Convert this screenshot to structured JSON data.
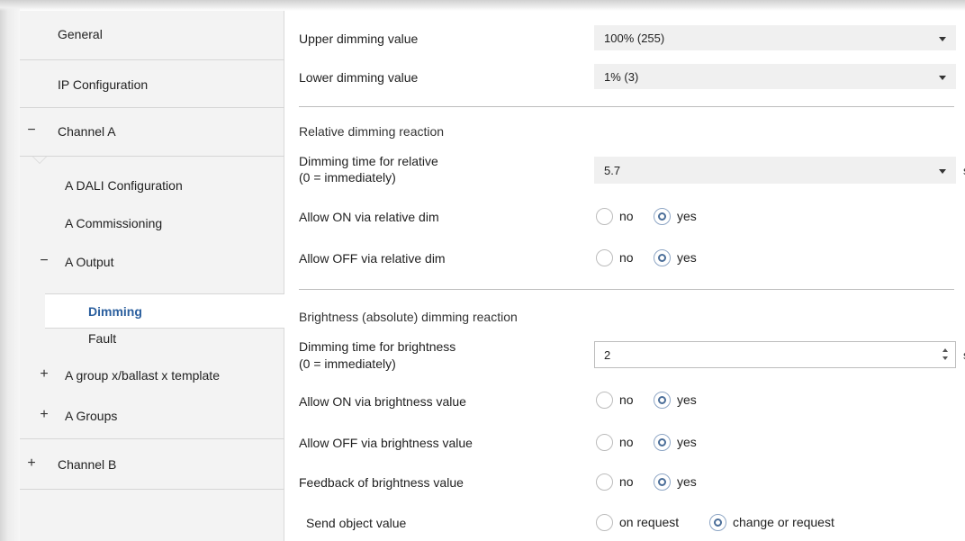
{
  "sidebar": {
    "items": [
      {
        "label": "General",
        "sign": ""
      },
      {
        "label": "IP Configuration",
        "sign": ""
      },
      {
        "label": "Channel A",
        "sign": "−"
      },
      {
        "label": "A DALI Configuration",
        "sign": ""
      },
      {
        "label": "A Commissioning",
        "sign": ""
      },
      {
        "label": "A Output",
        "sign": "−"
      },
      {
        "label": "Dimming",
        "sign": ""
      },
      {
        "label": "Fault",
        "sign": ""
      },
      {
        "label": "A group x/ballast x template",
        "sign": "+"
      },
      {
        "label": "A Groups",
        "sign": "+"
      },
      {
        "label": "Channel B",
        "sign": "+"
      }
    ],
    "selected": "Dimming"
  },
  "main": {
    "upper_dimming": {
      "label": "Upper dimming value",
      "value": "100% (255)"
    },
    "lower_dimming": {
      "label": "Lower dimming value",
      "value": "1% (3)"
    },
    "relative_section": {
      "title": "Relative dimming reaction"
    },
    "relative_time": {
      "label_line1": "Dimming time for relative",
      "label_line2": "(0 = immediately)",
      "value": "5.7",
      "unit": "s"
    },
    "allow_on_relative": {
      "label": "Allow ON via relative dim",
      "options": [
        "no",
        "yes"
      ],
      "selected": "yes"
    },
    "allow_off_relative": {
      "label": "Allow OFF via relative dim",
      "options": [
        "no",
        "yes"
      ],
      "selected": "yes"
    },
    "brightness_section": {
      "title": "Brightness (absolute) dimming reaction"
    },
    "brightness_time": {
      "label_line1": "Dimming time for brightness",
      "label_line2": "(0 = immediately)",
      "value": "2",
      "unit": "s"
    },
    "allow_on_brightness": {
      "label": "Allow ON via brightness value",
      "options": [
        "no",
        "yes"
      ],
      "selected": "yes"
    },
    "allow_off_brightness": {
      "label": "Allow OFF via brightness value",
      "options": [
        "no",
        "yes"
      ],
      "selected": "yes"
    },
    "feedback_brightness": {
      "label": "Feedback of brightness value",
      "options": [
        "no",
        "yes"
      ],
      "selected": "yes"
    },
    "send_object": {
      "label": "Send object value",
      "options": [
        "on request",
        "change or request"
      ],
      "selected": "change or request"
    }
  },
  "colors": {
    "selected_text": "#2b5f9e",
    "sidebar_bg": "#f3f3f3",
    "dropdown_bg": "#f0f0f0"
  }
}
